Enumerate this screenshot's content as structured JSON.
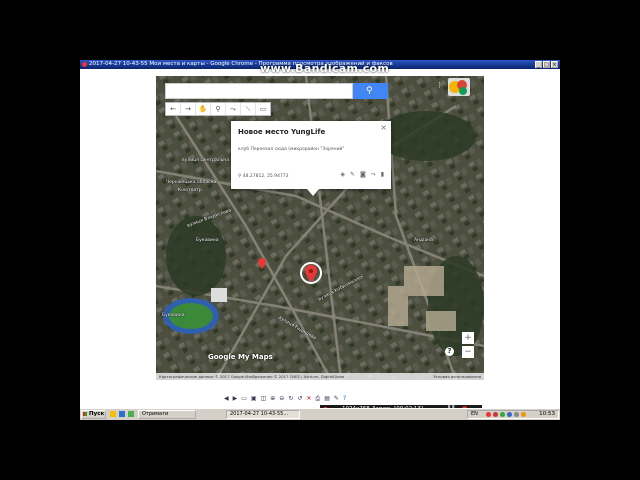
{
  "window": {
    "title": "2017-04-27 10-43-55 Мои места и карты - Google Chrome - Программа просмотра изображений и факсов",
    "buttons": [
      "_",
      "□",
      "×"
    ]
  },
  "watermark": "www.Bandicam.com",
  "map": {
    "search_placeholder": "",
    "toolbar": [
      "←",
      "→",
      "✋",
      "⚲",
      "⤳",
      "⟍",
      "▭"
    ],
    "menu_icon": "⋮",
    "info_window": {
      "title": "Новое место YungLife",
      "description": "клуб Переехал сюда (микрорайон \"Зоряний\"",
      "coords": "48.27812, 25.94773",
      "close": "×",
      "actions": [
        "paint-bucket-icon",
        "edit-icon",
        "camera-icon",
        "route-icon",
        "trash-icon"
      ]
    },
    "labels": [
      {
        "name": "label-vul-tsentralna",
        "text": "вулиця Центральна"
      },
      {
        "name": "label-chernivetska-oblast",
        "text": "Чернівецька обласна"
      },
      {
        "name": "label-kinotsentr",
        "text": "Кінотеатр"
      },
      {
        "name": "label-vul-vladyslava",
        "text": "вулиця Владислава"
      },
      {
        "name": "label-bukovyna",
        "text": "Буковина"
      },
      {
        "name": "label-andiana",
        "text": "Андіана"
      },
      {
        "name": "label-bukovyna-stadium",
        "text": "Буковина"
      },
      {
        "name": "label-vul-radyshcheva",
        "text": "вулиця Радищева"
      },
      {
        "name": "label-vul-kobylianskoi",
        "text": "вулиця Кобилянської"
      }
    ],
    "logo": "Google My Maps",
    "zoom_in": "+",
    "zoom_out": "−",
    "help": "?",
    "footer_left": "Картографические данные © 2017 Google Изображения © 2017 CNES / Astrium, DigitalGlobe",
    "footer_right": "Условия использования"
  },
  "status_bar": {
    "icons": [
      "back-icon",
      "forward-icon",
      "fit-icon",
      "actual-size-icon",
      "slideshow-icon",
      "zoom-in-icon",
      "zoom-out-icon",
      "rotate-cw-icon",
      "rotate-ccw-icon",
      "delete-icon",
      "print-icon",
      "save-icon",
      "edit-icon",
      "help-icon"
    ]
  },
  "recording": {
    "resolution": "1024x768",
    "time": "Запись [00:02:13]"
  },
  "taskbar": {
    "start": "Пуск",
    "items": [
      {
        "label": "Отримати",
        "active": false
      },
      {
        "label": "2017-04-27 10-43-55...",
        "active": true
      }
    ],
    "lang": "EN",
    "clock": "10:53"
  },
  "colors": {
    "titlebar": "#0a246a",
    "search_button": "#4285f4",
    "marker": "#e53935",
    "taskbar": "#d4d0c8"
  }
}
